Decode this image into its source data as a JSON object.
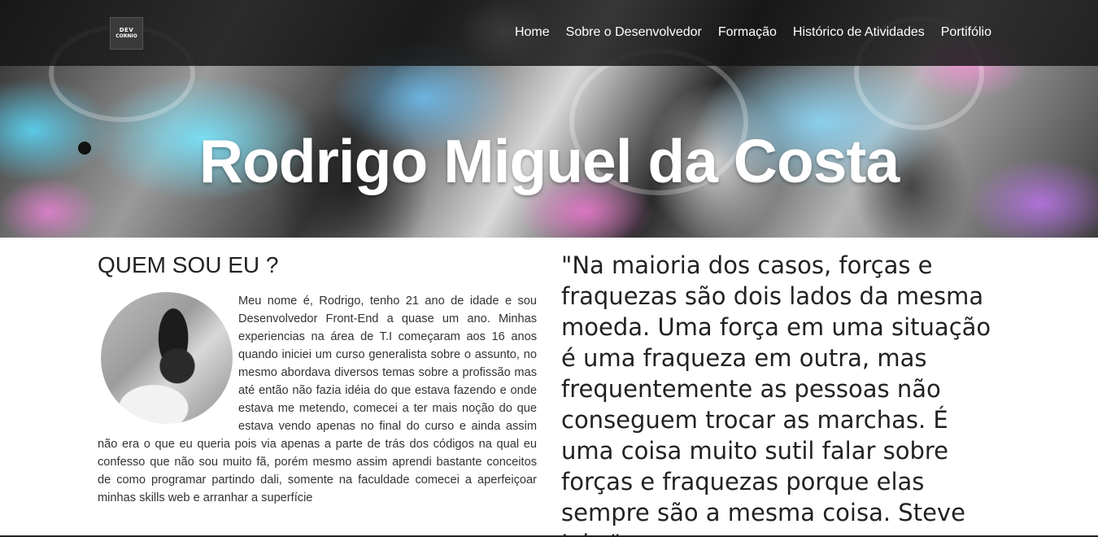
{
  "header": {
    "logo_text_top": "DEV",
    "logo_text_bottom": "CORNIO",
    "nav": [
      "Home",
      "Sobre o Desenvolvedor",
      "Formação",
      "Histórico de Atividades",
      "Portifólio"
    ]
  },
  "hero": {
    "title": "Rodrigo Miguel da Costa"
  },
  "about": {
    "heading": "QUEM SOU EU ?",
    "text": "Meu nome é, Rodrigo, tenho 21 ano de idade e sou Desenvolvedor Front-End a quase um ano. Minhas experiencias na área de T.I começaram aos 16 anos quando iniciei um curso generalista sobre o assunto, no mesmo abordava diversos temas sobre a profissão mas até então não fazia idéia do que estava fazendo e onde estava me metendo, comecei a ter mais noção do que estava vendo apenas no final do curso e ainda assim não era o que eu queria pois via apenas a parte de trás dos códigos na qual eu confesso que não sou muito fã, porém mesmo assim aprendi bastante conceitos de como programar partindo dali, somente na faculdade comecei a aperfeiçoar minhas skills web e arranhar a superfície"
  },
  "quote": {
    "text": "\"Na maioria dos casos, forças e fraquezas são dois lados da mesma moeda. Uma força em uma situação é uma fraqueza em outra, mas frequentemente as pessoas não conseguem trocar as marchas. É uma coisa muito sutil falar sobre forças e fraquezas porque elas sempre são a mesma coisa. Steve Jobs\""
  },
  "colors": {
    "navbar_bg": "#141414",
    "text": "#333333",
    "heading": "#222222"
  }
}
